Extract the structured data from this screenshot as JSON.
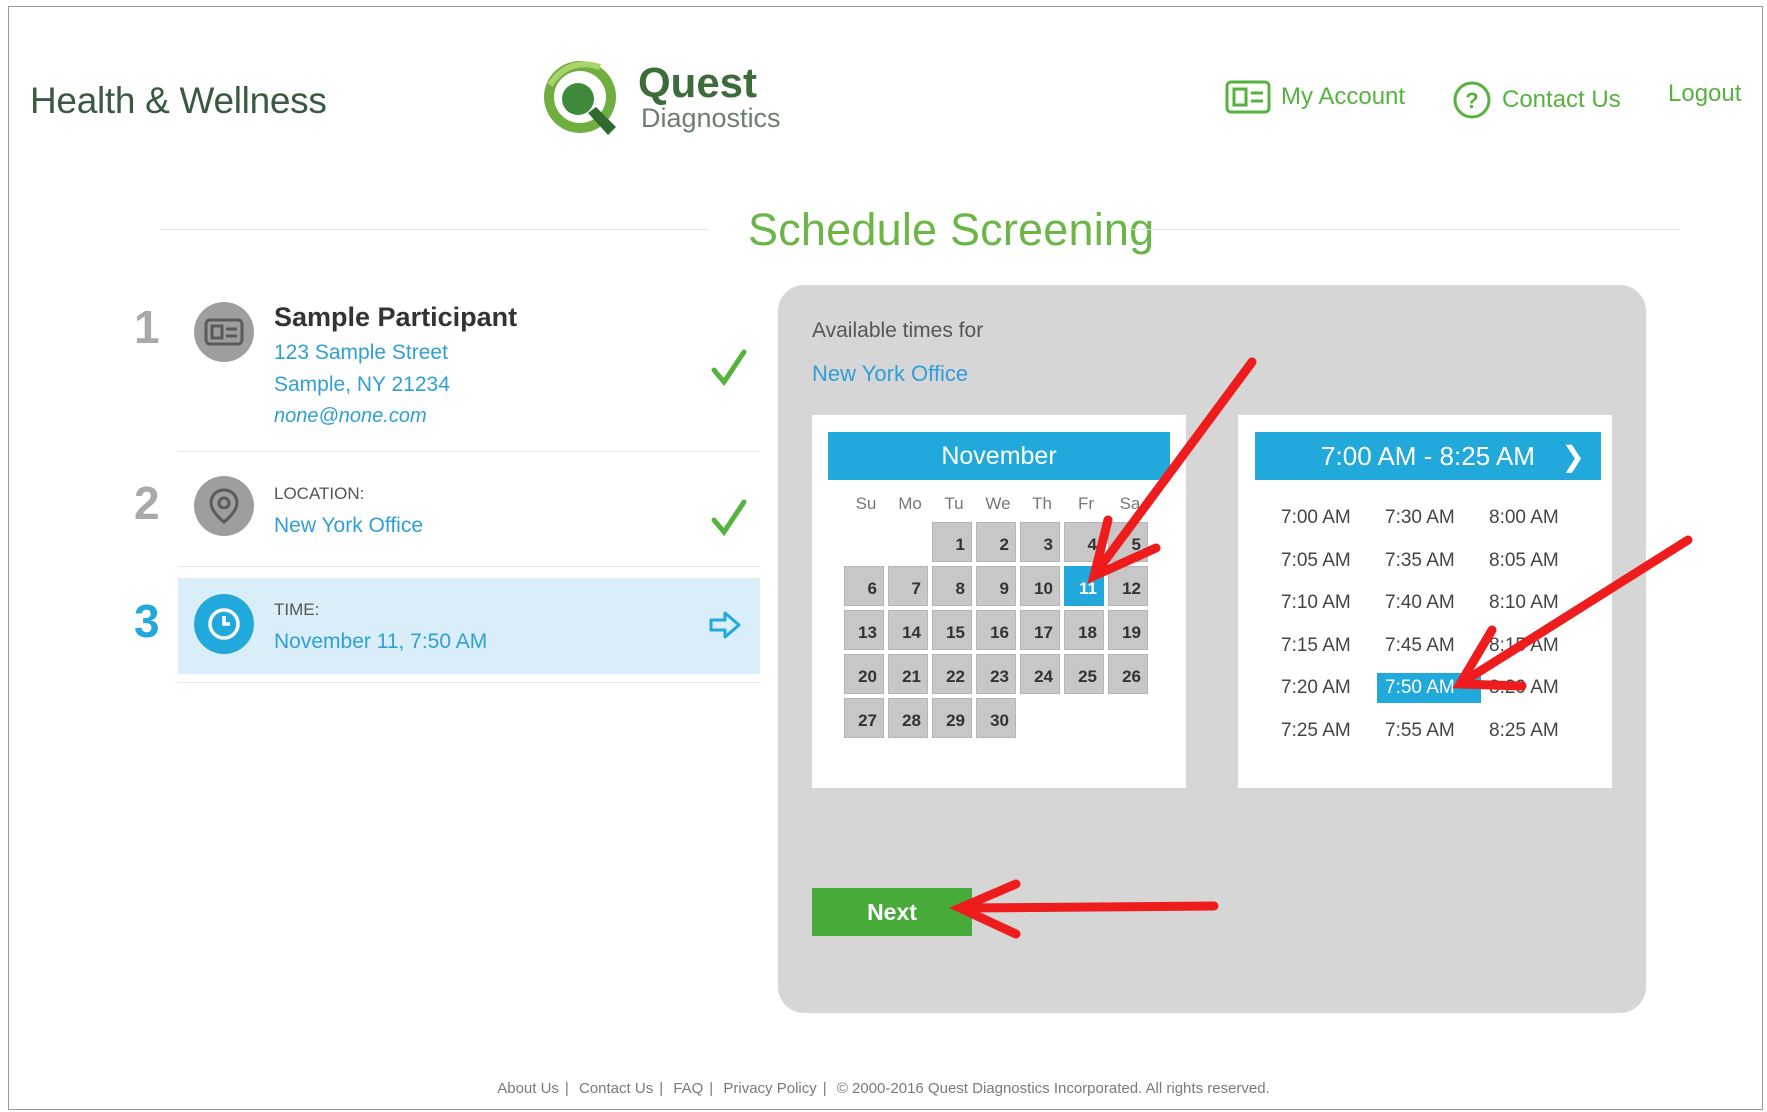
{
  "header": {
    "brand": "Health & Wellness",
    "logo_name": "Quest",
    "logo_sub": "Diagnostics",
    "nav": [
      {
        "label": "My Account",
        "icon": "id-card-icon"
      },
      {
        "label": "Contact Us",
        "icon": "question-circle-icon"
      },
      {
        "label": "Logout"
      }
    ]
  },
  "page_title": "Schedule Screening",
  "steps": [
    {
      "number": "1",
      "icon": "id-card-icon",
      "name": "Sample Participant",
      "address1": "123 Sample Street",
      "address2": "Sample, NY 21234",
      "email": "none@none.com",
      "status": "check"
    },
    {
      "number": "2",
      "icon": "location-pin-icon",
      "label": "LOCATION:",
      "value": "New York Office",
      "status": "check"
    },
    {
      "number": "3",
      "icon": "clock-icon",
      "label": "TIME:",
      "value": "November 11, 7:50 AM",
      "status": "arrow"
    }
  ],
  "panel": {
    "available_label": "Available times for",
    "location": "New York Office",
    "calendar": {
      "month": "November",
      "weekdays": [
        "Su",
        "Mo",
        "Tu",
        "We",
        "Th",
        "Fr",
        "Sa"
      ],
      "first_weekday_index": 2,
      "days_in_month": 30,
      "selected_day": 11
    },
    "times": {
      "range_label": "7:00 AM - 8:25 AM",
      "columns": [
        [
          "7:00 AM",
          "7:05 AM",
          "7:10 AM",
          "7:15 AM",
          "7:20 AM",
          "7:25 AM"
        ],
        [
          "7:30 AM",
          "7:35 AM",
          "7:40 AM",
          "7:45 AM",
          "7:50 AM",
          "7:55 AM"
        ],
        [
          "8:00 AM",
          "8:05 AM",
          "8:10 AM",
          "8:15 AM",
          "8:20 AM",
          "8:25 AM"
        ]
      ],
      "selected": "7:50 AM"
    },
    "next_label": "Next"
  },
  "footer": {
    "links": [
      "About Us",
      "Contact Us",
      "FAQ",
      "Privacy Policy"
    ],
    "copyright": "© 2000-2016 Quest Diagnostics Incorporated. All rights reserved."
  },
  "colors": {
    "accent_blue": "#21a9dc",
    "brand_green": "#6cb648",
    "button_green": "#47ab3a",
    "annotation_red": "#ee1c1c"
  }
}
